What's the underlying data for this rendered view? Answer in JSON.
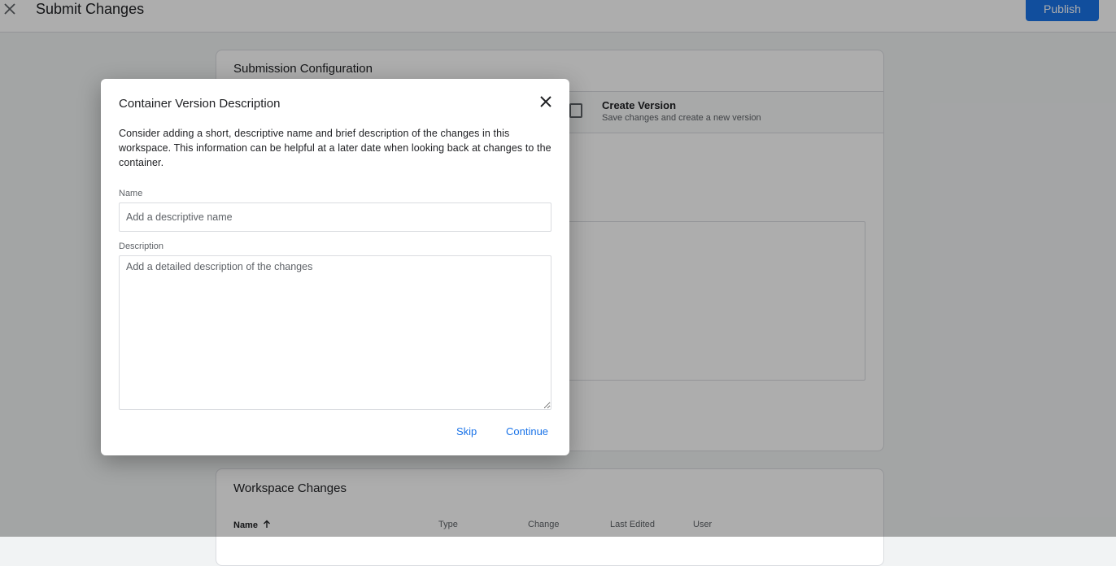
{
  "header": {
    "title": "Submit Changes",
    "publish_label": "Publish",
    "close_icon": "close-icon"
  },
  "config_card": {
    "title": "Submission Configuration",
    "create_version_title": "Create Version",
    "create_version_subtitle": "Save changes and create a new version"
  },
  "workspace_card": {
    "title": "Workspace Changes",
    "columns": [
      "Name",
      "Type",
      "Change",
      "Last Edited",
      "User"
    ],
    "sort_icon": "arrow-up-icon"
  },
  "dialog": {
    "title": "Container Version Description",
    "body": "Consider adding a short, descriptive name and brief description of the changes in this workspace. This information can be helpful at a later date when looking back at changes to the container.",
    "name_label": "Name",
    "name_placeholder": "Add a descriptive name",
    "name_value": "",
    "description_label": "Description",
    "description_placeholder": "Add a detailed description of the changes",
    "description_value": "",
    "skip_label": "Skip",
    "continue_label": "Continue"
  },
  "colors": {
    "accent": "#1a73e8",
    "scrim": "rgba(0,0,0,0.32)",
    "background": "#f1f3f4"
  }
}
